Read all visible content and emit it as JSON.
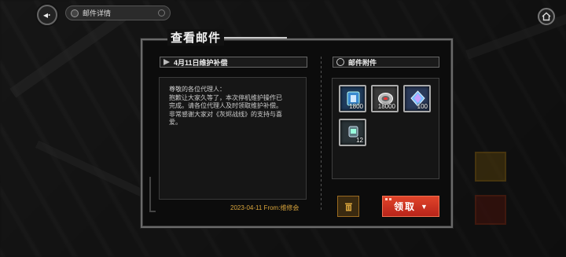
{
  "header": {
    "breadcrumb": "邮件详情"
  },
  "panel": {
    "title": "查看邮件"
  },
  "mail": {
    "subject": "4月11日维护补偿",
    "body_lines": [
      "尊敬的各位代理人：",
      "抱歉让大家久等了，本次停机维护操作已",
      "完成。请各位代理人及时领取维护补偿。",
      "非常感谢大家对《灰烬战线》的支持与喜",
      "爱。"
    ],
    "footer": "2023-04-11  From:维修会"
  },
  "attachments": {
    "header": "邮件附件",
    "items": [
      {
        "icon": "blue-token-icon",
        "qty": "1800"
      },
      {
        "icon": "silver-coin-icon",
        "qty": "18000"
      },
      {
        "icon": "crystal-icon",
        "qty": "100"
      },
      {
        "icon": "stamina-canister-icon",
        "qty": "12"
      }
    ]
  },
  "actions": {
    "claim_label": "领取"
  },
  "colors": {
    "accent_gold": "#d8a43c",
    "claim_red": "#d0341f"
  }
}
